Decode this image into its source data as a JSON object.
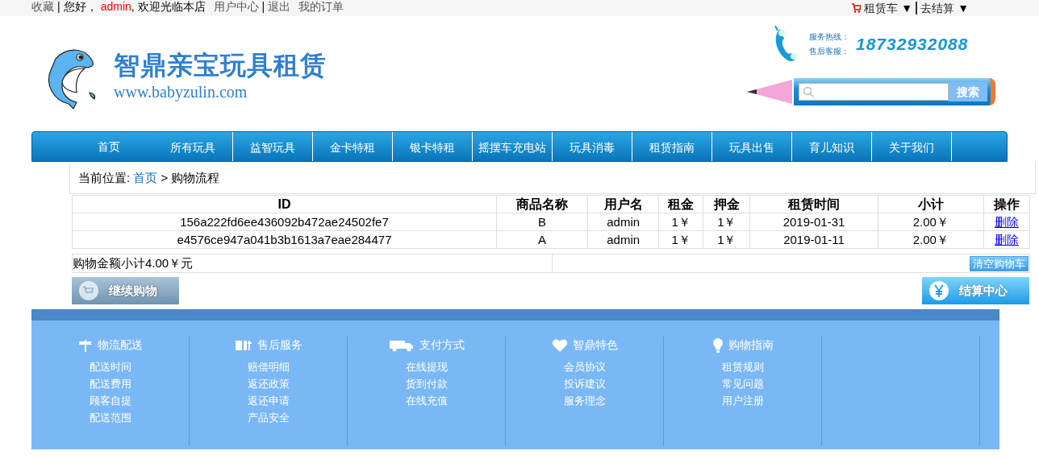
{
  "top_bar": {
    "favorite": "收藏",
    "greeting": "您好，",
    "user": "admin",
    "separator": "|",
    "welcome": ", 欢迎光临本店",
    "user_center": "用户中心",
    "logout": "退出",
    "orders": "我的订单",
    "cart": "租赁车",
    "cart_caret": "▼",
    "checkout": "去结算",
    "checkout_caret": "▼"
  },
  "header": {
    "logo_title": "智鼎亲宝玩具租赁",
    "logo_url": "www.babyzulin.com",
    "hotline_label": "服务热线：",
    "aftersales_label": "售后客服：",
    "phone": "18732932088",
    "search_button": "搜索"
  },
  "nav": [
    "首页",
    "所有玩具",
    "益智玩具",
    "金卡特租",
    "银卡特租",
    "摇摆车充电站",
    "玩具消毒",
    "租赁指南",
    "玩具出售",
    "育儿知识",
    "关于我们"
  ],
  "breadcrumb": {
    "label": "当前位置:",
    "home": "首页",
    "separator": ">",
    "current": "购物流程"
  },
  "cart": {
    "columns": [
      "ID",
      "商品名称",
      "用户名",
      "租金",
      "押金",
      "租赁时间",
      "小计",
      "操作"
    ],
    "rows": [
      {
        "cells": [
          "156a222fd6ee436092b472ae24502fe7",
          "B",
          "admin",
          "1￥",
          "1￥",
          "2019-01-31",
          "2.00￥"
        ],
        "action": "删除"
      },
      {
        "cells": [
          "e4576ce947a041b3b1613a7eae284477",
          "A",
          "admin",
          "1￥",
          "1￥",
          "2019-01-11",
          "2.00￥"
        ],
        "action": "删除"
      }
    ],
    "total": "购物金额小计4.00￥元",
    "clear_button": "清空购物车",
    "continue_button": "继续购物",
    "checkout_button": "结算中心"
  },
  "footer": [
    {
      "title": "物流配送",
      "links": [
        "配送时间",
        "配送费用",
        "顾客自提",
        "配送范围"
      ]
    },
    {
      "title": "售后服务",
      "links": [
        "赔偿明细",
        "返还政策",
        "返还申请",
        "产品安全"
      ]
    },
    {
      "title": "支付方式",
      "links": [
        "在线提现",
        "货到付款",
        "在线充值"
      ]
    },
    {
      "title": "智鼎特色",
      "links": [
        "会员协议",
        "投诉建议",
        "服务理念"
      ]
    },
    {
      "title": "购物指南",
      "links": [
        "租赁规则",
        "常见问题",
        "用户注册"
      ]
    }
  ]
}
